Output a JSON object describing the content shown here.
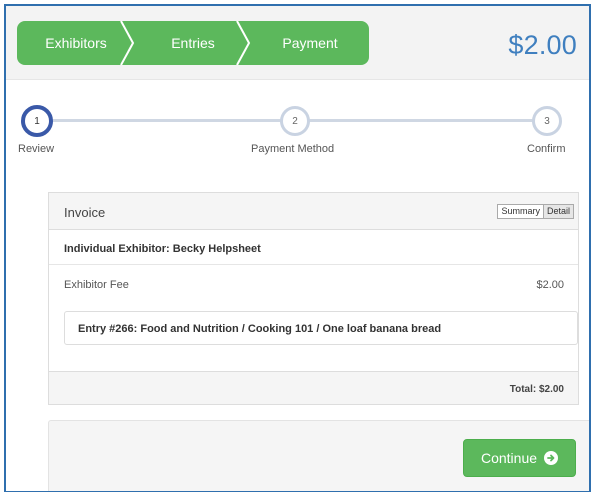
{
  "header": {
    "steps": [
      {
        "label": "Exhibitors"
      },
      {
        "label": "Entries"
      },
      {
        "label": "Payment"
      }
    ],
    "total": "$2.00",
    "accent_color": "#5cb85c",
    "total_color": "#3f7fbf"
  },
  "progress": {
    "steps": [
      {
        "number": "1",
        "label": "Review",
        "state": "active"
      },
      {
        "number": "2",
        "label": "Payment Method",
        "state": "pending"
      },
      {
        "number": "3",
        "label": "Confirm",
        "state": "pending"
      }
    ]
  },
  "invoice": {
    "title": "Invoice",
    "view_options": [
      "Summary",
      "Detail"
    ],
    "selected_view": "Detail",
    "exhibitor": "Individual Exhibitor: Becky Helpsheet",
    "fee_label": "Exhibitor Fee",
    "fee_amount": "$2.00",
    "entry": "Entry #266: Food and Nutrition / Cooking 101 / One loaf banana bread",
    "total": "Total: $2.00"
  },
  "actions": {
    "continue_label": "Continue",
    "continue_icon": "arrow-circle-right-icon"
  }
}
